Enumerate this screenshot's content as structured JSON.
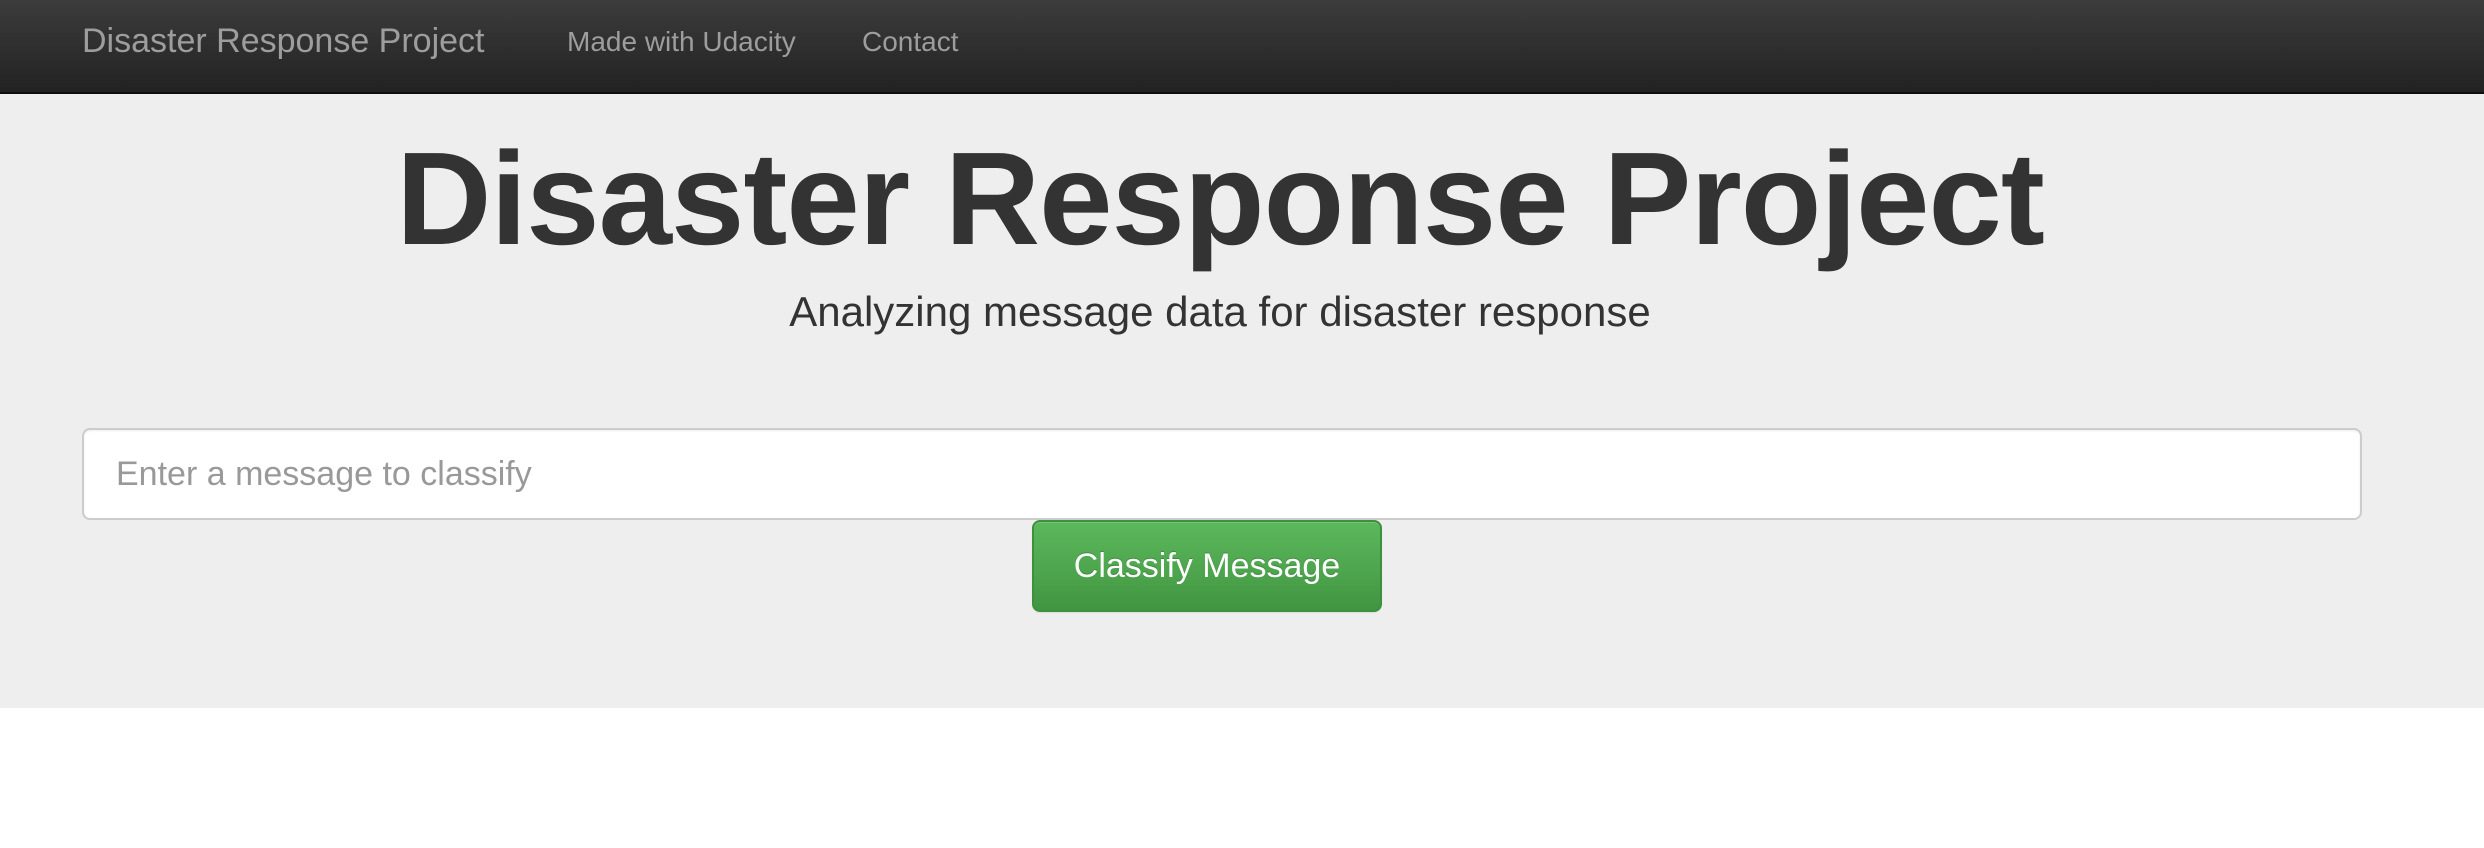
{
  "navbar": {
    "brand": "Disaster Response Project",
    "links": [
      {
        "label": "Made with Udacity"
      },
      {
        "label": "Contact"
      }
    ]
  },
  "hero": {
    "title": "Disaster Response Project",
    "subtitle": "Analyzing message data for disaster response"
  },
  "form": {
    "query_value": "",
    "query_placeholder": "Enter a message to classify",
    "submit_label": "Classify Message"
  },
  "colors": {
    "navbar_bg": "#222222",
    "nav_text": "#9d9d9d",
    "jumbotron_bg": "#eeeeee",
    "heading_text": "#333333",
    "button_green": "#5cb85c"
  }
}
